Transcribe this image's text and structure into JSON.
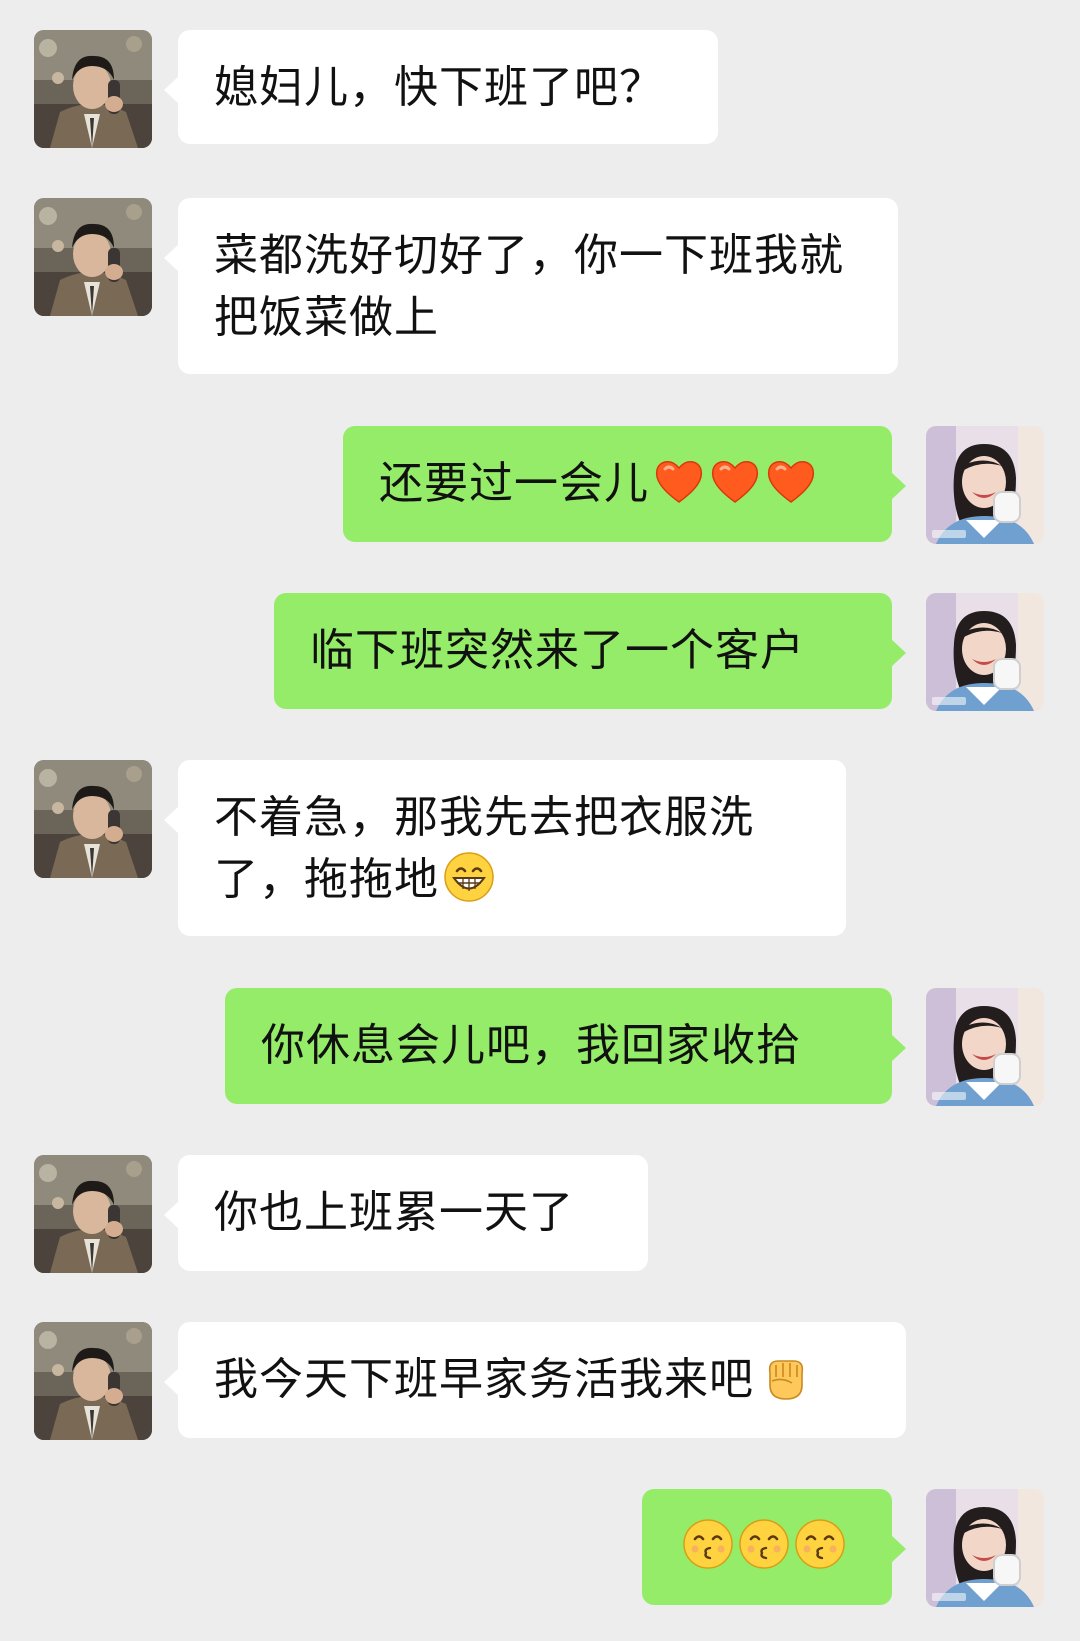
{
  "messages": [
    {
      "side": "in",
      "text": "媳妇儿，快下班了吧？"
    },
    {
      "side": "in",
      "text": "菜都洗好切好了，你一下班我就把饭菜做上"
    },
    {
      "side": "out",
      "text": "还要过一会儿",
      "emoji": [
        "heart",
        "heart",
        "heart"
      ]
    },
    {
      "side": "out",
      "text": "临下班突然来了一个客户"
    },
    {
      "side": "in",
      "text": "不着急，那我先去把衣服洗了，拖拖地",
      "emoji": [
        "grin"
      ]
    },
    {
      "side": "out",
      "text": "你休息会儿吧，我回家收拾"
    },
    {
      "side": "in",
      "text": "你也上班累一天了"
    },
    {
      "side": "in",
      "text": "我今天下班早家务活我来吧",
      "emoji": [
        "fist"
      ]
    },
    {
      "side": "out",
      "text": "",
      "emoji": [
        "kiss",
        "kiss",
        "kiss"
      ]
    }
  ],
  "colors": {
    "background": "#ededed",
    "incoming_bubble": "#ffffff",
    "outgoing_bubble": "#95ec69"
  }
}
